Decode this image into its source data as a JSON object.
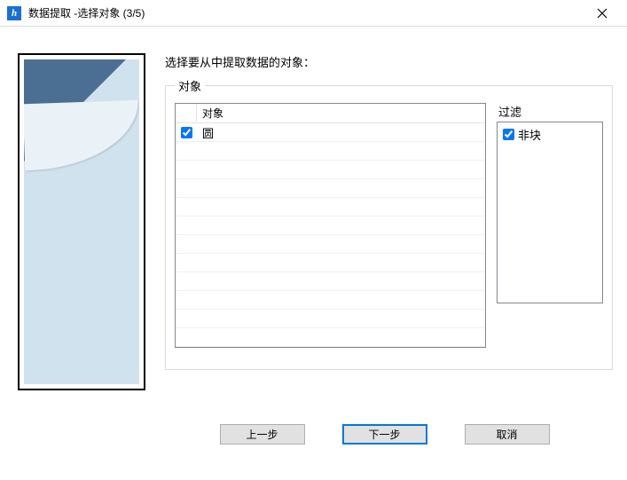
{
  "window": {
    "title": "数据提取 -选择对象 (3/5)"
  },
  "instruction": "选择要从中提取数据的对象：",
  "objects_group_label": "对象",
  "objects_header": "对象",
  "objects": [
    {
      "label": "圆",
      "checked": true
    }
  ],
  "filter_label": "过滤",
  "filters": [
    {
      "label": "非块",
      "checked": true
    }
  ],
  "buttons": {
    "back": "上一步",
    "next": "下一步",
    "cancel": "取消"
  }
}
